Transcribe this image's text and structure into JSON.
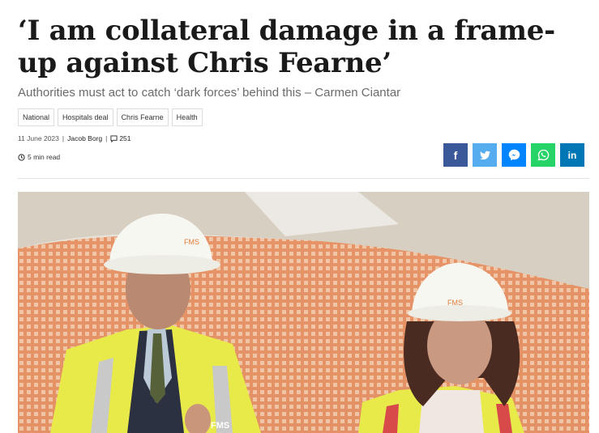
{
  "article": {
    "headline": "‘I am collateral damage in a frame-up against Chris Fearne’",
    "subtitle": "Authorities must act to catch ‘dark forces’ behind this – Carmen Ciantar",
    "tags": [
      "National",
      "Hospitals deal",
      "Chris Fearne",
      "Health"
    ],
    "date": "11 June 2023",
    "author": "Jacob Borg",
    "comment_count": "251",
    "read_time": "5 min read"
  },
  "share": [
    {
      "icon": "facebook-icon",
      "color": "#3b5998"
    },
    {
      "icon": "twitter-icon",
      "color": "#55acee"
    },
    {
      "icon": "messenger-icon",
      "color": "#0084ff"
    },
    {
      "icon": "whatsapp-icon",
      "color": "#25d366"
    },
    {
      "icon": "linkedin-icon",
      "color": "#0077b5"
    }
  ],
  "photo": {
    "helmet_logo_text": "FMS",
    "vest_logo_text": "FMS"
  }
}
